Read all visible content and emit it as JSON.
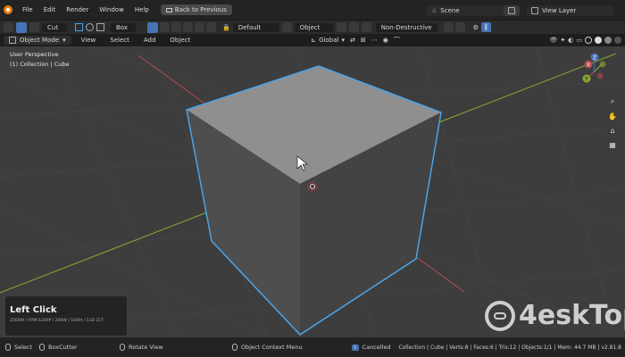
{
  "menu": {
    "items": [
      "File",
      "Edit",
      "Render",
      "Window",
      "Help"
    ],
    "back_button": "Back to Previous",
    "scene_label": "Scene",
    "view_layer_label": "View Layer"
  },
  "toolbar": {
    "cut_label": "Cut",
    "box_label": "Box",
    "default_label": "Default",
    "object_label": "Object",
    "non_destructive_label": "Non-Destructive"
  },
  "viewheader": {
    "mode_label": "Object Mode",
    "view_label": "View",
    "select_label": "Select",
    "add_label": "Add",
    "object_label": "Object",
    "orientation_label": "Global"
  },
  "viewport": {
    "perspective_label": "User Perspective",
    "collection_label": "(1) Collection | Cube",
    "axis_x": "X",
    "axis_y": "Y",
    "axis_z": "Z"
  },
  "overlay": {
    "title": "Left Click",
    "subtitle": "2560W / P.RM 1200P / 200W / 1000t / 51D 21T"
  },
  "status": {
    "select": "Select",
    "boxcutter": "BoxCutter",
    "rotate": "Rotate View",
    "context": "Object Context Menu",
    "cancelled": "Cancelled",
    "stats": "Collection | Cube | Verts:8 | Faces:6 | Tris:12 | Objects:1/1 | Mem: 44.7 MB | v2.81.8"
  },
  "watermark": {
    "text": "4eskTop"
  },
  "colors": {
    "accent": "#4772b3",
    "selection_outline": "#4aa3e8",
    "x_axis": "#b84b4b",
    "y_axis": "#8aaa32"
  }
}
